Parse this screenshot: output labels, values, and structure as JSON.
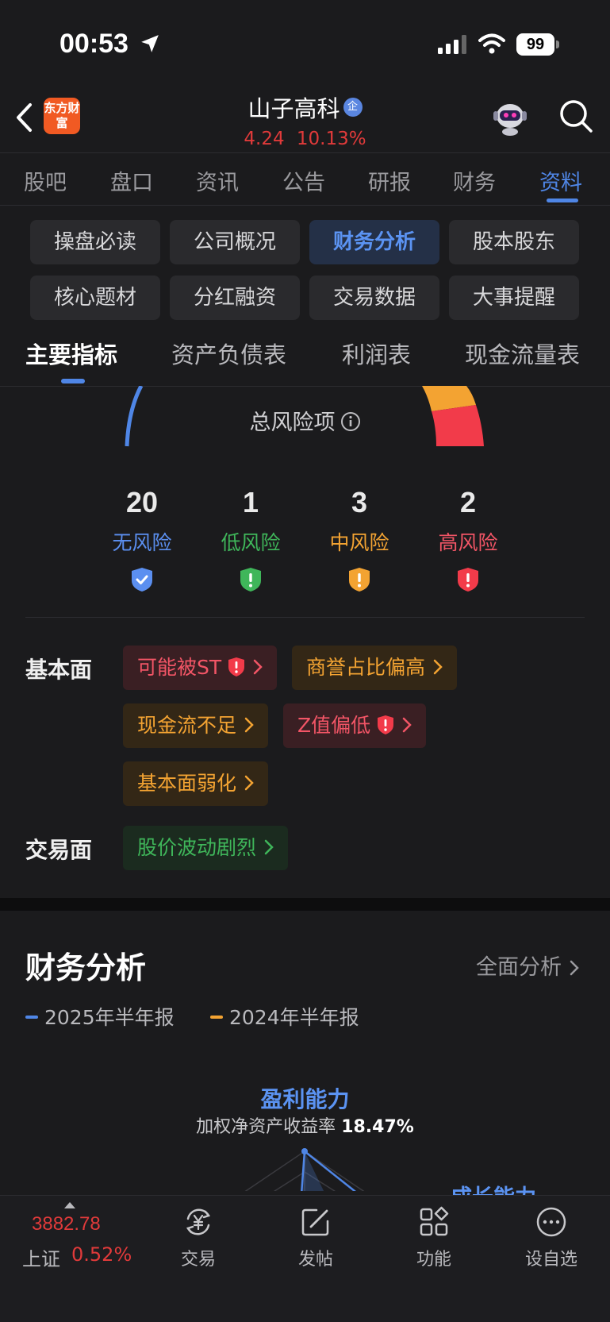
{
  "status_bar": {
    "time": "00:53",
    "battery": "99"
  },
  "header": {
    "app_logo": "东方财富",
    "stock_name": "山子高科",
    "ent_badge": "企",
    "price": "4.24",
    "change_pct": "10.13%",
    "colors": {
      "up": "#e03a3a",
      "accent": "#4f86e6"
    }
  },
  "tabs": [
    "股吧",
    "盘口",
    "资讯",
    "公告",
    "研报",
    "财务",
    "资料"
  ],
  "active_tab": "资料",
  "chips": [
    "操盘必读",
    "公司概况",
    "财务分析",
    "股本股东",
    "核心题材",
    "分红融资",
    "交易数据",
    "大事提醒"
  ],
  "active_chip": "财务分析",
  "sub_tabs": [
    "主要指标",
    "资产负债表",
    "利润表",
    "现金流量表"
  ],
  "risk": {
    "title": "总风险项",
    "counts": [
      {
        "value": "20",
        "label": "无风险",
        "color": "#5b8ff0"
      },
      {
        "value": "1",
        "label": "低风险",
        "color": "#3fb65a"
      },
      {
        "value": "3",
        "label": "中风险",
        "color": "#f3a332"
      },
      {
        "value": "2",
        "label": "高风险",
        "color": "#f25566"
      }
    ]
  },
  "fundamentals": {
    "label": "基本面",
    "tags": [
      {
        "text": "可能被ST",
        "level": "red"
      },
      {
        "text": "商誉占比偏高",
        "level": "orange"
      },
      {
        "text": "现金流不足",
        "level": "orange"
      },
      {
        "text": "Z值偏低",
        "level": "red"
      },
      {
        "text": "基本面弱化",
        "level": "orange"
      }
    ]
  },
  "trading": {
    "label": "交易面",
    "tags": [
      {
        "text": "股价波动剧烈",
        "level": "green"
      }
    ]
  },
  "financial_analysis": {
    "title": "财务分析",
    "more": "全面分析",
    "legend": [
      {
        "label": "2025年半年报",
        "color": "#4f86e6"
      },
      {
        "label": "2024年半年报",
        "color": "#f3a332"
      }
    ],
    "radar_title": "盈利能力",
    "radar_metric_label": "加权净资产收益率",
    "radar_metric_value": "18.47%",
    "radar_right_label": "成长能力"
  },
  "bottom_nav": {
    "index_value": "3882.78",
    "index_name": "上证",
    "index_change": "0.52%",
    "items": [
      "交易",
      "发帖",
      "功能",
      "设自选"
    ]
  }
}
